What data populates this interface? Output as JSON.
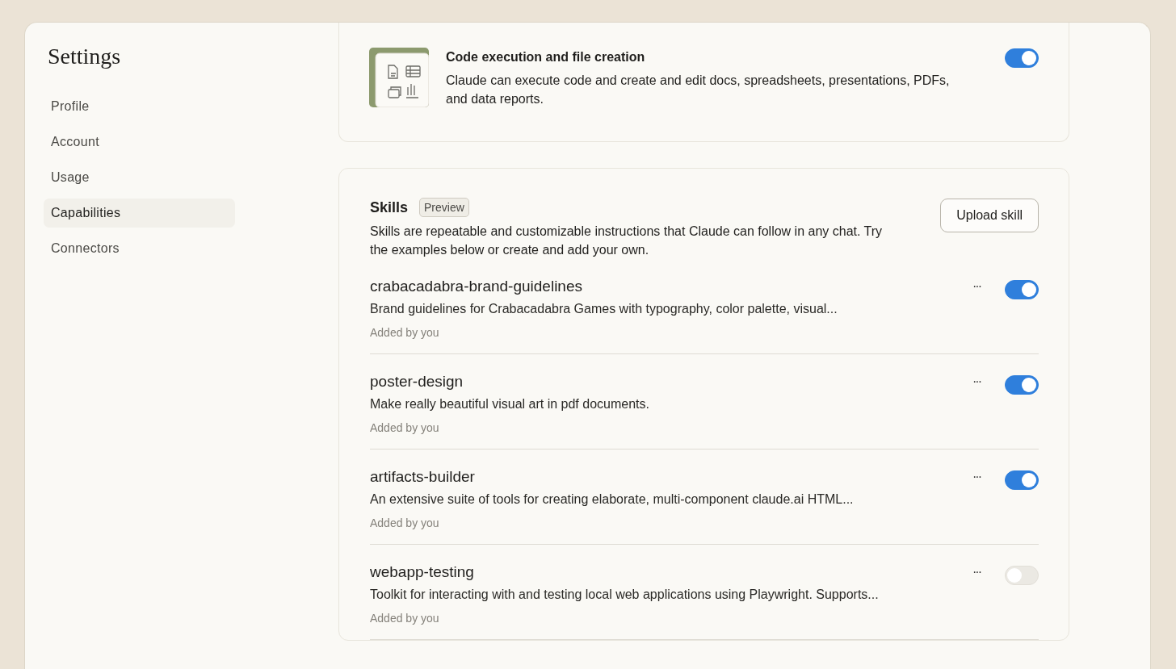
{
  "sidebar": {
    "title": "Settings",
    "items": [
      {
        "label": "Profile",
        "selected": false
      },
      {
        "label": "Account",
        "selected": false
      },
      {
        "label": "Usage",
        "selected": false
      },
      {
        "label": "Capabilities",
        "selected": true
      },
      {
        "label": "Connectors",
        "selected": false
      }
    ]
  },
  "feature": {
    "title": "Code execution and file creation",
    "description": "Claude can execute code and create and edit docs, spreadsheets, presentations, PDFs, and data reports.",
    "on": true
  },
  "skills": {
    "title": "Skills",
    "badge": "Preview",
    "description": "Skills are repeatable and customizable instructions that Claude can follow in any chat. Try the examples below or create and add your own.",
    "upload_button": "Upload skill",
    "items": [
      {
        "name": "crabacadabra-brand-guidelines",
        "description": "Brand guidelines for Crabacadabra Games with typography, color palette, visual...",
        "added_by": "Added by you",
        "menu": "···",
        "on": true
      },
      {
        "name": "poster-design",
        "description": "Make really beautiful visual art in pdf documents.",
        "added_by": "Added by you",
        "menu": "···",
        "on": true
      },
      {
        "name": "artifacts-builder",
        "description": "An extensive suite of tools for creating elaborate, multi-component claude.ai HTML...",
        "added_by": "Added by you",
        "menu": "···",
        "on": true
      },
      {
        "name": "webapp-testing",
        "description": "Toolkit for interacting with and testing local web applications using Playwright. Supports...",
        "added_by": "Added by you",
        "menu": "···",
        "on": false
      }
    ]
  }
}
